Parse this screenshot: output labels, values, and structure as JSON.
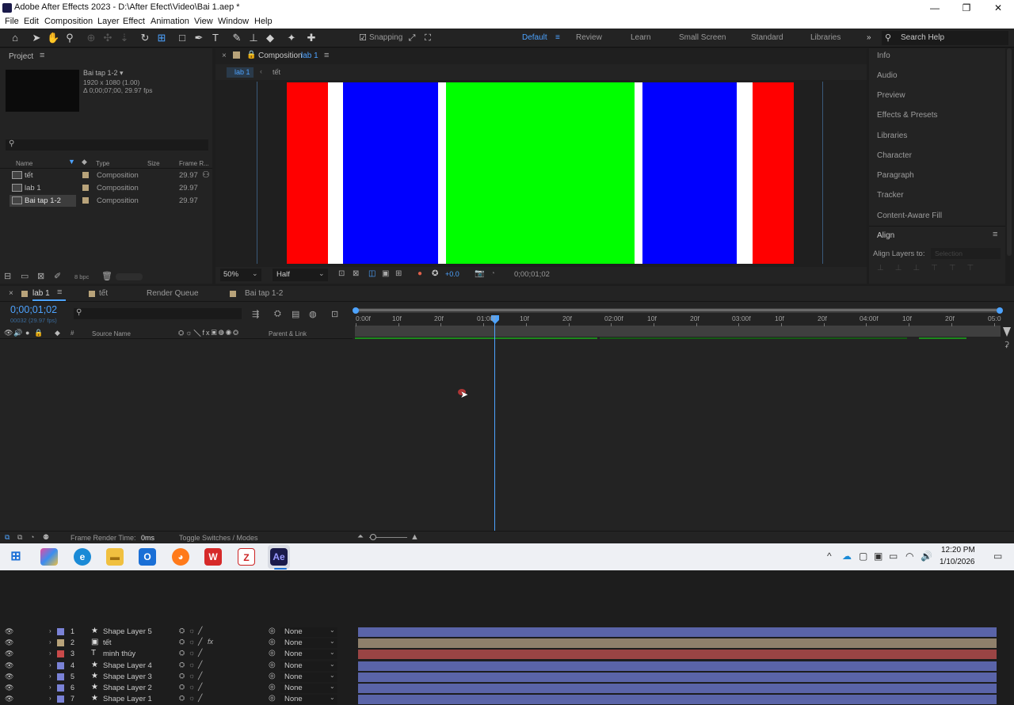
{
  "window": {
    "title": "Adobe After Effects 2023 - D:\\After Efect\\Video\\Bai 1.aep *"
  },
  "menu": [
    "File",
    "Edit",
    "Composition",
    "Layer",
    "Effect",
    "Animation",
    "View",
    "Window",
    "Help"
  ],
  "toolbar": {
    "snapping_label": "Snapping",
    "workspaces": [
      "Default",
      "Review",
      "Learn",
      "Small Screen",
      "Standard",
      "Libraries"
    ],
    "search_placeholder": "Search Help"
  },
  "project": {
    "title": "Project",
    "selected_name": "Bai tap 1-2 ▾",
    "selected_size": "1920 x 1080 (1.00)",
    "selected_info": "Δ 0;00;07;00, 29.97 fps",
    "columns": [
      "Name",
      "Type",
      "Size",
      "Frame R..."
    ],
    "items": [
      {
        "name": "tết",
        "type": "Composition",
        "fps": "29.97"
      },
      {
        "name": "lab 1",
        "type": "Composition",
        "fps": "29.97"
      },
      {
        "name": "Bai tap 1-2",
        "type": "Composition",
        "fps": "29.97"
      }
    ],
    "bpc": "8 bpc"
  },
  "comp": {
    "tab_label": "Composition",
    "tab_name": "lab 1",
    "breadcrumb": [
      "lab 1",
      "tết"
    ],
    "zoom": "50%",
    "resolution": "Half",
    "exposure": "+0.0",
    "timecode": "0;00;01;02",
    "stripes": [
      "#ff0000",
      "#ffffff",
      "#0000ff",
      "#ffffff",
      "#00ff00",
      "#ffffff",
      "#0000ff",
      "#ffffff",
      "#ff0000"
    ]
  },
  "right_panels": [
    "Info",
    "Audio",
    "Preview",
    "Effects & Presets",
    "Libraries",
    "Character",
    "Paragraph",
    "Tracker",
    "Content-Aware Fill"
  ],
  "align": {
    "title": "Align",
    "align_to_label": "Align Layers to:",
    "align_to_value": "Selection"
  },
  "timeline": {
    "tabs": [
      "lab 1",
      "tết",
      "Render Queue",
      "Bai tap 1-2"
    ],
    "timecode": "0;00;01;02",
    "subtimecode": "00032 (29.97 fps)",
    "col_source": "Source Name",
    "col_parent": "Parent & Link",
    "ruler": [
      "0:00f",
      "10f",
      "20f",
      "01:00f",
      "10f",
      "20f",
      "02:00f",
      "10f",
      "20f",
      "03:00f",
      "10f",
      "20f",
      "04:00f",
      "10f",
      "20f",
      "05:0"
    ],
    "layers": [
      {
        "num": "1",
        "name": "Shape Layer 5",
        "color": "#7a82d6",
        "kind": "shape",
        "parent": "None",
        "bar": "#5a64a8"
      },
      {
        "num": "2",
        "name": "tết",
        "color": "#b8a37a",
        "kind": "comp",
        "parent": "None",
        "bar": "#8f806b"
      },
      {
        "num": "3",
        "name": "minh thúy",
        "color": "#c94a4a",
        "kind": "text",
        "parent": "None",
        "bar": "#9a4444"
      },
      {
        "num": "4",
        "name": "Shape Layer 4",
        "color": "#7a82d6",
        "kind": "shape",
        "parent": "None",
        "bar": "#5a64a8"
      },
      {
        "num": "5",
        "name": "Shape Layer 3",
        "color": "#7a82d6",
        "kind": "shape",
        "parent": "None",
        "bar": "#5a64a8"
      },
      {
        "num": "6",
        "name": "Shape Layer 2",
        "color": "#7a82d6",
        "kind": "shape",
        "parent": "None",
        "bar": "#5a64a8"
      },
      {
        "num": "7",
        "name": "Shape Layer 1",
        "color": "#7a82d6",
        "kind": "shape",
        "parent": "None",
        "bar": "#5a64a8"
      }
    ],
    "frame_render_label": "Frame Render Time:",
    "frame_render_value": "0ms",
    "toggle_label": "Toggle Switches / Modes"
  },
  "taskbar": {
    "time": "12:20 PM",
    "date": "1/10/2026"
  }
}
